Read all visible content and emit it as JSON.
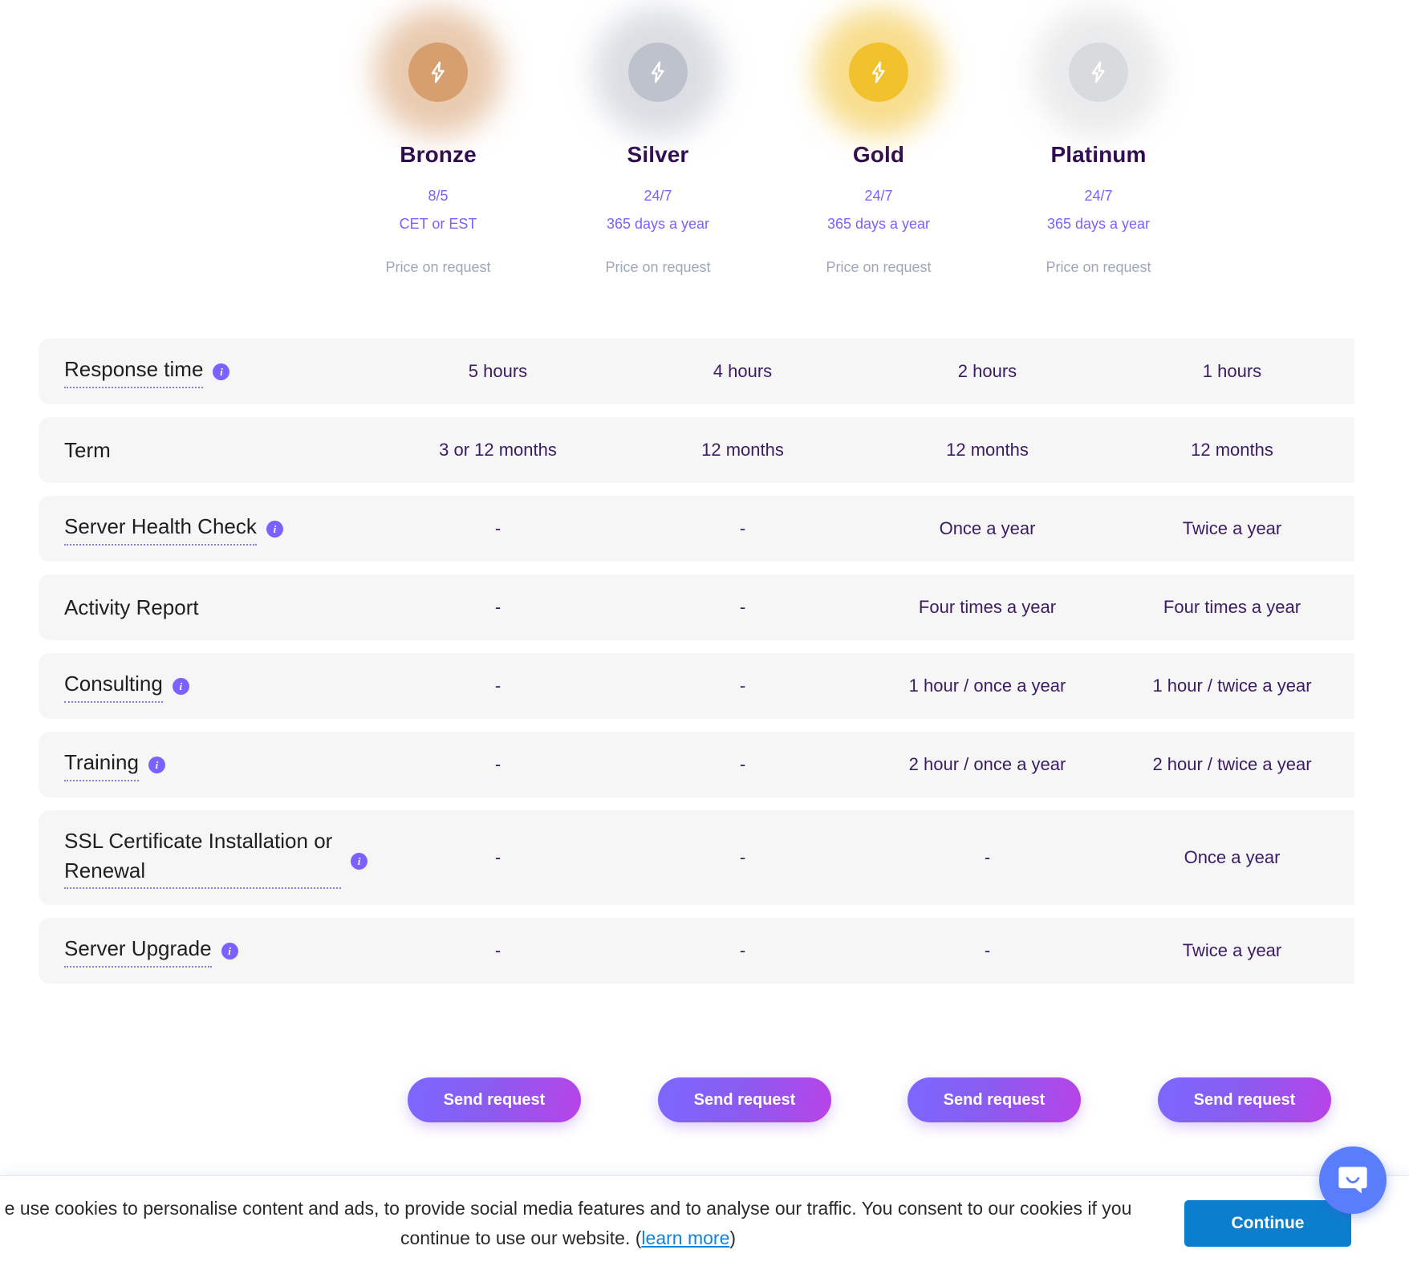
{
  "plans": [
    {
      "name": "Bronze",
      "availability": "8/5",
      "coverage": "CET or EST",
      "price": "Price on request",
      "cta": "Send request",
      "badge_color": "#d79f6e",
      "icon": "lightning-bolt-icon"
    },
    {
      "name": "Silver",
      "availability": "24/7",
      "coverage": "365 days a year",
      "price": "Price on request",
      "cta": "Send request",
      "badge_color": "#bdc2cc",
      "icon": "lightning-bolt-icon"
    },
    {
      "name": "Gold",
      "availability": "24/7",
      "coverage": "365 days a year",
      "price": "Price on request",
      "cta": "Send request",
      "badge_color": "#f2c12e",
      "icon": "lightning-bolt-icon"
    },
    {
      "name": "Platinum",
      "availability": "24/7",
      "coverage": "365 days a year",
      "price": "Price on request",
      "cta": "Send request",
      "badge_color": "#d9dadc",
      "icon": "lightning-bolt-icon"
    }
  ],
  "features": [
    {
      "label": "Response time",
      "has_info": true,
      "dotted": true,
      "multiline": false,
      "values": [
        "5 hours",
        "4 hours",
        "2 hours",
        "1 hours"
      ]
    },
    {
      "label": "Term",
      "has_info": false,
      "dotted": false,
      "multiline": false,
      "values": [
        "3 or 12 months",
        "12 months",
        "12 months",
        "12 months"
      ]
    },
    {
      "label": "Server Health Check",
      "has_info": true,
      "dotted": true,
      "multiline": false,
      "values": [
        "-",
        "-",
        "Once a year",
        "Twice a year"
      ]
    },
    {
      "label": "Activity Report",
      "has_info": false,
      "dotted": false,
      "multiline": false,
      "values": [
        "-",
        "-",
        "Four times a year",
        "Four times a year"
      ]
    },
    {
      "label": "Consulting",
      "has_info": true,
      "dotted": true,
      "multiline": false,
      "values": [
        "-",
        "-",
        "1 hour / once a year",
        "1 hour / twice a year"
      ]
    },
    {
      "label": "Training",
      "has_info": true,
      "dotted": true,
      "multiline": false,
      "values": [
        "-",
        "-",
        "2 hour / once a year",
        "2 hour / twice a year"
      ]
    },
    {
      "label": "SSL Certificate Installation or Renewal",
      "has_info": true,
      "dotted": true,
      "multiline": true,
      "values": [
        "-",
        "-",
        "-",
        "Once a year"
      ]
    },
    {
      "label": "Server Upgrade",
      "has_info": true,
      "dotted": true,
      "multiline": false,
      "values": [
        "-",
        "-",
        "-",
        "Twice a year"
      ]
    }
  ],
  "cookie_banner": {
    "text_before_link": "e use cookies to personalise content and ads, to provide social media features and to analyse our traffic. You consent to our cookies if you continue to use our website. (",
    "link_label": "learn more",
    "text_after_link": ")",
    "continue_label": "Continue",
    "accent_color": "#0b7fce"
  },
  "chat_widget": {
    "icon": "chat-bubble-smile-icon",
    "color": "#5a7dfb"
  },
  "theme": {
    "row_background": "#f6f6f6",
    "accent_purple": "#7b61ff",
    "cell_text": "#3b1c63",
    "plan_title": "#2d0a4e",
    "price_muted": "#9ea7b8"
  }
}
